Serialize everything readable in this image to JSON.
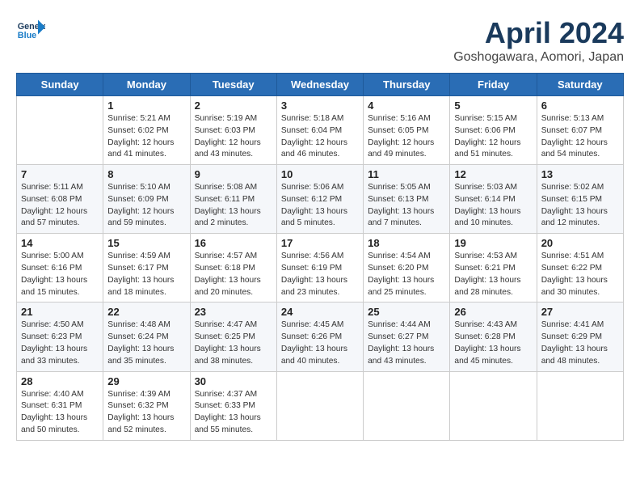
{
  "logo": {
    "general": "General",
    "blue": "Blue"
  },
  "title": "April 2024",
  "location": "Goshogawara, Aomori, Japan",
  "weekdays": [
    "Sunday",
    "Monday",
    "Tuesday",
    "Wednesday",
    "Thursday",
    "Friday",
    "Saturday"
  ],
  "weeks": [
    [
      {
        "day": "",
        "info": ""
      },
      {
        "day": "1",
        "info": "Sunrise: 5:21 AM\nSunset: 6:02 PM\nDaylight: 12 hours\nand 41 minutes."
      },
      {
        "day": "2",
        "info": "Sunrise: 5:19 AM\nSunset: 6:03 PM\nDaylight: 12 hours\nand 43 minutes."
      },
      {
        "day": "3",
        "info": "Sunrise: 5:18 AM\nSunset: 6:04 PM\nDaylight: 12 hours\nand 46 minutes."
      },
      {
        "day": "4",
        "info": "Sunrise: 5:16 AM\nSunset: 6:05 PM\nDaylight: 12 hours\nand 49 minutes."
      },
      {
        "day": "5",
        "info": "Sunrise: 5:15 AM\nSunset: 6:06 PM\nDaylight: 12 hours\nand 51 minutes."
      },
      {
        "day": "6",
        "info": "Sunrise: 5:13 AM\nSunset: 6:07 PM\nDaylight: 12 hours\nand 54 minutes."
      }
    ],
    [
      {
        "day": "7",
        "info": "Sunrise: 5:11 AM\nSunset: 6:08 PM\nDaylight: 12 hours\nand 57 minutes."
      },
      {
        "day": "8",
        "info": "Sunrise: 5:10 AM\nSunset: 6:09 PM\nDaylight: 12 hours\nand 59 minutes."
      },
      {
        "day": "9",
        "info": "Sunrise: 5:08 AM\nSunset: 6:11 PM\nDaylight: 13 hours\nand 2 minutes."
      },
      {
        "day": "10",
        "info": "Sunrise: 5:06 AM\nSunset: 6:12 PM\nDaylight: 13 hours\nand 5 minutes."
      },
      {
        "day": "11",
        "info": "Sunrise: 5:05 AM\nSunset: 6:13 PM\nDaylight: 13 hours\nand 7 minutes."
      },
      {
        "day": "12",
        "info": "Sunrise: 5:03 AM\nSunset: 6:14 PM\nDaylight: 13 hours\nand 10 minutes."
      },
      {
        "day": "13",
        "info": "Sunrise: 5:02 AM\nSunset: 6:15 PM\nDaylight: 13 hours\nand 12 minutes."
      }
    ],
    [
      {
        "day": "14",
        "info": "Sunrise: 5:00 AM\nSunset: 6:16 PM\nDaylight: 13 hours\nand 15 minutes."
      },
      {
        "day": "15",
        "info": "Sunrise: 4:59 AM\nSunset: 6:17 PM\nDaylight: 13 hours\nand 18 minutes."
      },
      {
        "day": "16",
        "info": "Sunrise: 4:57 AM\nSunset: 6:18 PM\nDaylight: 13 hours\nand 20 minutes."
      },
      {
        "day": "17",
        "info": "Sunrise: 4:56 AM\nSunset: 6:19 PM\nDaylight: 13 hours\nand 23 minutes."
      },
      {
        "day": "18",
        "info": "Sunrise: 4:54 AM\nSunset: 6:20 PM\nDaylight: 13 hours\nand 25 minutes."
      },
      {
        "day": "19",
        "info": "Sunrise: 4:53 AM\nSunset: 6:21 PM\nDaylight: 13 hours\nand 28 minutes."
      },
      {
        "day": "20",
        "info": "Sunrise: 4:51 AM\nSunset: 6:22 PM\nDaylight: 13 hours\nand 30 minutes."
      }
    ],
    [
      {
        "day": "21",
        "info": "Sunrise: 4:50 AM\nSunset: 6:23 PM\nDaylight: 13 hours\nand 33 minutes."
      },
      {
        "day": "22",
        "info": "Sunrise: 4:48 AM\nSunset: 6:24 PM\nDaylight: 13 hours\nand 35 minutes."
      },
      {
        "day": "23",
        "info": "Sunrise: 4:47 AM\nSunset: 6:25 PM\nDaylight: 13 hours\nand 38 minutes."
      },
      {
        "day": "24",
        "info": "Sunrise: 4:45 AM\nSunset: 6:26 PM\nDaylight: 13 hours\nand 40 minutes."
      },
      {
        "day": "25",
        "info": "Sunrise: 4:44 AM\nSunset: 6:27 PM\nDaylight: 13 hours\nand 43 minutes."
      },
      {
        "day": "26",
        "info": "Sunrise: 4:43 AM\nSunset: 6:28 PM\nDaylight: 13 hours\nand 45 minutes."
      },
      {
        "day": "27",
        "info": "Sunrise: 4:41 AM\nSunset: 6:29 PM\nDaylight: 13 hours\nand 48 minutes."
      }
    ],
    [
      {
        "day": "28",
        "info": "Sunrise: 4:40 AM\nSunset: 6:31 PM\nDaylight: 13 hours\nand 50 minutes."
      },
      {
        "day": "29",
        "info": "Sunrise: 4:39 AM\nSunset: 6:32 PM\nDaylight: 13 hours\nand 52 minutes."
      },
      {
        "day": "30",
        "info": "Sunrise: 4:37 AM\nSunset: 6:33 PM\nDaylight: 13 hours\nand 55 minutes."
      },
      {
        "day": "",
        "info": ""
      },
      {
        "day": "",
        "info": ""
      },
      {
        "day": "",
        "info": ""
      },
      {
        "day": "",
        "info": ""
      }
    ]
  ]
}
